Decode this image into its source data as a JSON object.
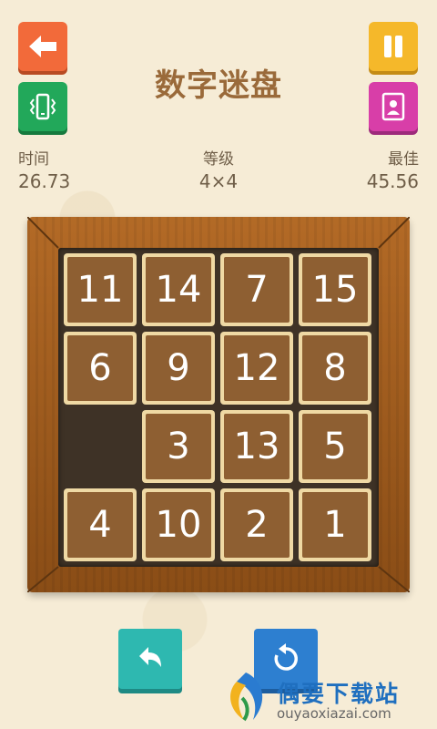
{
  "header": {
    "title": "数字迷盘"
  },
  "stats": {
    "time": {
      "label": "时间",
      "value": "26.73"
    },
    "level": {
      "label": "等级",
      "value": "4×4"
    },
    "best": {
      "label": "最佳",
      "value": "45.56"
    }
  },
  "icons": {
    "back": "back-arrow-icon",
    "shake": "phone-vibrate-icon",
    "pause": "pause-icon",
    "profile": "profile-icon",
    "undo": "undo-icon",
    "reset": "reset-icon"
  },
  "board": {
    "size": 4,
    "tiles": [
      [
        "11",
        "14",
        "7",
        "15"
      ],
      [
        "6",
        "9",
        "12",
        "8"
      ],
      [
        "",
        "3",
        "13",
        "5"
      ],
      [
        "4",
        "10",
        "2",
        "1"
      ]
    ]
  },
  "watermark": {
    "name": "偶要下载站",
    "url": "ouyaoxiazai.com"
  },
  "colors": {
    "back": "#f26a3a",
    "shake": "#22a85a",
    "pause": "#f5b82a",
    "profile": "#d83ea8",
    "undo": "#2eb8b0",
    "reset": "#2d7fd0",
    "tile_face": "#8e5f32",
    "tile_rim": "#efd9a4"
  }
}
